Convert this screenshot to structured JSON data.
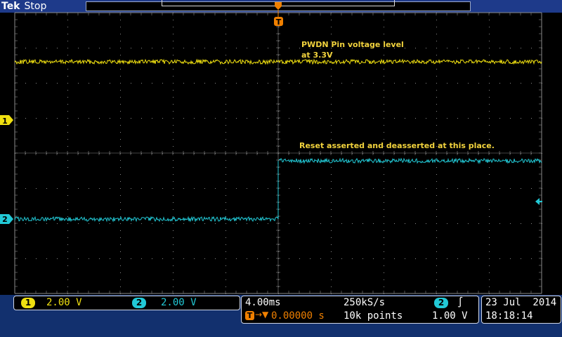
{
  "header": {
    "brand": "Tek",
    "run_state": "Stop",
    "trigger_marker": "T"
  },
  "annotations": {
    "ch1_note_line1": "PWDN Pin voltage level",
    "ch1_note_line2": "at 3.3V",
    "reset_note": "Reset asserted and deasserted at this place."
  },
  "channels": [
    {
      "number": "1",
      "scale": "2.00 V",
      "color": "#f0e010"
    },
    {
      "number": "2",
      "scale": "2.00 V",
      "color": "#22c9d6"
    }
  ],
  "horizontal": {
    "time_per_div": "4.00ms",
    "sample_rate": "250kS/s",
    "trigger_position": "0.00000 s",
    "record_length": "10k points"
  },
  "trigger": {
    "source": "2",
    "slope_symbol": "∫",
    "level": "1.00 V"
  },
  "datetime": {
    "date": "23 Jul  2014",
    "time": "18:18:14"
  },
  "colors": {
    "grid": "#8a8a8a",
    "status_bg": "#12306e",
    "ch1": "#f0e010",
    "ch2": "#22c9d6",
    "trigger_orange": "#f08000",
    "annotation": "#f2d33d"
  }
}
